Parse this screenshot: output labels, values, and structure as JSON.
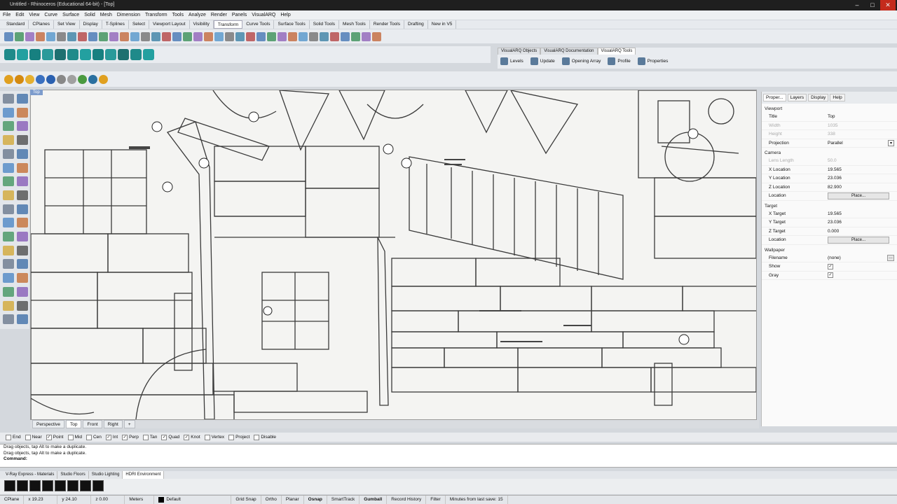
{
  "window": {
    "title": "Untitled - Rhinoceros (Educational 64-bit) - [Top]",
    "controls": [
      "–",
      "□",
      "✕"
    ]
  },
  "menu": [
    "File",
    "Edit",
    "View",
    "Curve",
    "Surface",
    "Solid",
    "Mesh",
    "Dimension",
    "Transform",
    "Tools",
    "Analyze",
    "Render",
    "Panels",
    "VisualARQ",
    "Help"
  ],
  "toolbar_tabs": [
    "Standard",
    "CPlanes",
    "Set View",
    "Display",
    "T-Splines",
    "Select",
    "Viewport Layout",
    "Visibility",
    "Transform",
    "Curve Tools",
    "Surface Tools",
    "Solid Tools",
    "Mesh Tools",
    "Render Tools",
    "Drafting",
    "New in V5"
  ],
  "toolbar_active_tab": "Transform",
  "visualarq": {
    "tabs": [
      "VisualARQ Objects",
      "VisualARQ Documentation",
      "VisualARQ Tools"
    ],
    "active": "VisualARQ Tools",
    "buttons": [
      "Levels",
      "Update",
      "Opening Array",
      "Profile",
      "Properties"
    ]
  },
  "viewport": {
    "label": "Top",
    "tabs": [
      "Perspective",
      "Top",
      "Front",
      "Right",
      "+"
    ],
    "active_tab": "Top"
  },
  "panel": {
    "tabs": [
      "Proper...",
      "Layers",
      "Display",
      "Help"
    ],
    "active_tab": "Proper...",
    "viewport_section": "Viewport",
    "viewport_rows": [
      {
        "k": "Title",
        "v": "Top",
        "dis": false
      },
      {
        "k": "Width",
        "v": "1035",
        "dis": true
      },
      {
        "k": "Height",
        "v": "338",
        "dis": true
      },
      {
        "k": "Projection",
        "v": "Parallel",
        "dis": false
      }
    ],
    "camera_section": "Camera",
    "camera_rows": [
      {
        "k": "Lens Length",
        "v": "50.0",
        "dis": true
      },
      {
        "k": "X Location",
        "v": "19.565",
        "dis": false
      },
      {
        "k": "Y Location",
        "v": "23.036",
        "dis": false
      },
      {
        "k": "Z Location",
        "v": "82.900",
        "dis": false
      }
    ],
    "camera_location_label": "Location",
    "place_button": "Place...",
    "target_section": "Target",
    "target_rows": [
      {
        "k": "X Target",
        "v": "19.565"
      },
      {
        "k": "Y Target",
        "v": "23.036"
      },
      {
        "k": "Z Target",
        "v": "0.000"
      }
    ],
    "target_location_label": "Location",
    "wallpaper_section": "Wallpaper",
    "wallpaper_filename_label": "Filename",
    "wallpaper_filename": "(none)",
    "wallpaper_show_label": "Show",
    "wallpaper_gray_label": "Gray"
  },
  "osnaps": [
    {
      "label": "End",
      "on": false
    },
    {
      "label": "Near",
      "on": false
    },
    {
      "label": "Point",
      "on": true
    },
    {
      "label": "Mid",
      "on": false
    },
    {
      "label": "Cen",
      "on": false
    },
    {
      "label": "Int",
      "on": true
    },
    {
      "label": "Perp",
      "on": true
    },
    {
      "label": "Tan",
      "on": false
    },
    {
      "label": "Quad",
      "on": true
    },
    {
      "label": "Knot",
      "on": true
    },
    {
      "label": "Vertex",
      "on": false
    },
    {
      "label": "Project",
      "on": false
    },
    {
      "label": "Disable",
      "on": false
    }
  ],
  "command": {
    "history": [
      "Drag objects, tap Alt to make a duplicate.",
      "Drag objects, tap Alt to make a duplicate."
    ],
    "prompt": "Command:"
  },
  "bottom_tabs": [
    "V-Ray Express - Materials",
    "Studio Floors",
    "Studio Lighting",
    "HDRI Environment"
  ],
  "bottom_active_tab": "HDRI Environment",
  "status": {
    "cplane": "CPlane",
    "x": "x 19.23",
    "y": "y 24.10",
    "z": "z 0.00",
    "units": "Meters",
    "layer": "Default",
    "toggles": [
      "Grid Snap",
      "Ortho",
      "Planar",
      "Osnap",
      "SmartTrack",
      "Gumball",
      "Record History",
      "Filter"
    ],
    "bold_toggles": [
      "Osnap",
      "Gumball"
    ],
    "info": "Minutes from last save: 15"
  }
}
